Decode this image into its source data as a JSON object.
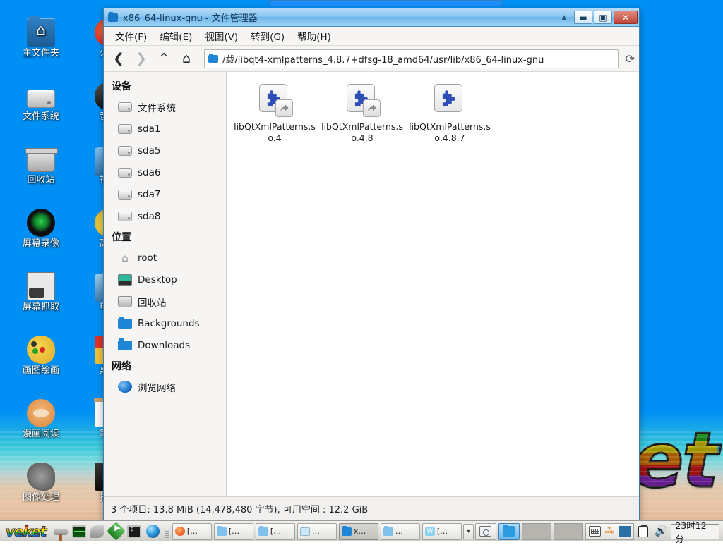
{
  "desktop": {
    "icons": [
      {
        "label": "主文件夹",
        "icon": "home-folder-icon",
        "cls": "ic-folderhome",
        "col": 0,
        "row": 0
      },
      {
        "label": "文件系统",
        "icon": "filesystem-drive-icon",
        "cls": "ic-hdd",
        "col": 0,
        "row": 1
      },
      {
        "label": "回收站",
        "icon": "trash-icon",
        "cls": "ic-trash",
        "col": 0,
        "row": 2
      },
      {
        "label": "屏幕录像",
        "icon": "screen-recorder-icon",
        "cls": "ic-cam",
        "col": 0,
        "row": 3
      },
      {
        "label": "屏幕抓取",
        "icon": "screenshot-icon",
        "cls": "ic-shot",
        "col": 0,
        "row": 4
      },
      {
        "label": "画图绘画",
        "icon": "paint-icon",
        "cls": "ic-paint",
        "col": 0,
        "row": 5
      },
      {
        "label": "漫画阅读",
        "icon": "comic-reader-icon",
        "cls": "ic-monkey",
        "col": 0,
        "row": 6
      },
      {
        "label": "图像处理",
        "icon": "gimp-icon",
        "cls": "ic-gimp",
        "col": 0,
        "row": 7
      },
      {
        "label": "火狐",
        "icon": "firefox-icon",
        "cls": "ic-fox",
        "col": 1,
        "row": 0
      },
      {
        "label": "音乐",
        "icon": "music-player-icon",
        "cls": "ic-mouse",
        "col": 1,
        "row": 1
      },
      {
        "label": "视频",
        "icon": "video-player-icon",
        "cls": "ic-video",
        "col": 1,
        "row": 2
      },
      {
        "label": "高级",
        "icon": "advanced-tools-icon",
        "cls": "ic-chick",
        "col": 1,
        "row": 3
      },
      {
        "label": "电视",
        "icon": "tv-icon",
        "cls": "ic-tv",
        "col": 1,
        "row": 4
      },
      {
        "label": "桌面",
        "icon": "desktop-settings-icon",
        "cls": "ic-desk",
        "col": 1,
        "row": 5
      },
      {
        "label": "笔记",
        "icon": "notes-icon",
        "cls": "ic-note",
        "col": 1,
        "row": 6
      },
      {
        "label": "拍摄",
        "icon": "capture-icon",
        "cls": "ic-speaker",
        "col": 1,
        "row": 7
      }
    ],
    "wallpaper_logo": "et"
  },
  "window": {
    "title": "x86_64-linux-gnu  -  文件管理器",
    "controls": {
      "shade": "▲",
      "minimize": "▬",
      "maximize": "▣",
      "close": "✕"
    },
    "menubar": [
      "文件(F)",
      "编辑(E)",
      "视图(V)",
      "转到(G)",
      "帮助(H)"
    ],
    "nav": {
      "back": "❮",
      "forward": "❯",
      "up": "⌃",
      "home": "⌂",
      "reload": "⟳"
    },
    "path": "载/libqt4-xmlpatterns_4.8.7+dfsg-18_amd64/usr/lib/x86_64-linux-gnu/",
    "statusbar": "3 个项目: 13.8 MiB (14,478,480 字节),  可用空间 :  12.2 GiB"
  },
  "sidebar": {
    "sections": [
      {
        "heading": "设备",
        "items": [
          {
            "label": "文件系统",
            "icon": "drive-icon",
            "cls": "drive"
          },
          {
            "label": "sda1",
            "icon": "drive-icon",
            "cls": "drive"
          },
          {
            "label": "sda5",
            "icon": "drive-icon",
            "cls": "drive"
          },
          {
            "label": "sda6",
            "icon": "drive-icon",
            "cls": "drive"
          },
          {
            "label": "sda7",
            "icon": "drive-icon",
            "cls": "drive"
          },
          {
            "label": "sda8",
            "icon": "drive-icon",
            "cls": "drive"
          }
        ]
      },
      {
        "heading": "位置",
        "items": [
          {
            "label": "root",
            "icon": "home-icon",
            "cls": "home",
            "glyph": "⌂"
          },
          {
            "label": "Desktop",
            "icon": "desktop-icon",
            "cls": "desktop"
          },
          {
            "label": "回收站",
            "icon": "trash-icon",
            "cls": "trash"
          },
          {
            "label": "Backgrounds",
            "icon": "folder-icon",
            "cls": "folder"
          },
          {
            "label": "Downloads",
            "icon": "folder-icon",
            "cls": "folder"
          }
        ]
      },
      {
        "heading": "网络",
        "items": [
          {
            "label": "浏览网络",
            "icon": "globe-icon",
            "cls": "globe"
          }
        ]
      }
    ]
  },
  "files": [
    {
      "name": "libQtXmlPatterns.so.4",
      "icon": "shared-library-icon",
      "symlink": true
    },
    {
      "name": "libQtXmlPatterns.so.4.8",
      "icon": "shared-library-icon",
      "symlink": true
    },
    {
      "name": "libQtXmlPatterns.so.4.8.7",
      "icon": "shared-library-icon",
      "symlink": false
    }
  ],
  "taskbar": {
    "logo": "veket",
    "quick_launch": [
      {
        "icon": "hammer-icon",
        "cls": "qi-hammer"
      },
      {
        "icon": "system-monitor-icon",
        "cls": "qi-monitor"
      },
      {
        "icon": "tools-icon",
        "cls": "qi-tools"
      },
      {
        "icon": "media-play-icon",
        "cls": "qi-play"
      },
      {
        "icon": "terminal-icon",
        "cls": "qi-term"
      },
      {
        "icon": "browser-globe-icon",
        "cls": "qi-globe"
      }
    ],
    "windows": [
      {
        "label": "[…",
        "icon": "firefox-icon",
        "cls": "fox",
        "active": false
      },
      {
        "label": "[…",
        "icon": "folder-icon",
        "cls": "folder",
        "active": false
      },
      {
        "label": "[…",
        "icon": "folder-icon",
        "cls": "folder",
        "active": false
      },
      {
        "label": "…",
        "icon": "camera-icon",
        "cls": "cam",
        "active": false
      },
      {
        "label": "x…",
        "icon": "folder-icon",
        "cls": "folder-dark",
        "active": true
      },
      {
        "label": "…",
        "icon": "folder-icon",
        "cls": "folder",
        "active": false
      },
      {
        "label": "[…",
        "icon": "wps-icon",
        "cls": "wps",
        "active": false
      }
    ],
    "overflow": "▾",
    "tray": [
      {
        "icon": "screenshot-tray-icon",
        "cls": "ti-cam",
        "state": "off"
      },
      {
        "icon": "file-manager-tray-icon",
        "cls": "ti-folder",
        "state": "on"
      }
    ],
    "tray_blanks": 2,
    "tray_right": [
      {
        "icon": "keyboard-icon",
        "cls": "ti-kbd"
      },
      {
        "icon": "fcitx-input-icon",
        "cls": "ti-fcitx",
        "glyph": "⁂"
      },
      {
        "icon": "signal-bars-icon",
        "cls": "ti-sig"
      }
    ],
    "clipboard_icon": "clipboard-icon",
    "volume_icon": "volume-icon",
    "volume_glyph": "🔊",
    "clock": "23时12分"
  },
  "colors": {
    "desktop_blue": "#0090f5",
    "title_active": "#8cc6f0",
    "close_red": "#bf4436",
    "accent_blue": "#1e86d6",
    "puzzle_blue": "#2f4fb8"
  }
}
